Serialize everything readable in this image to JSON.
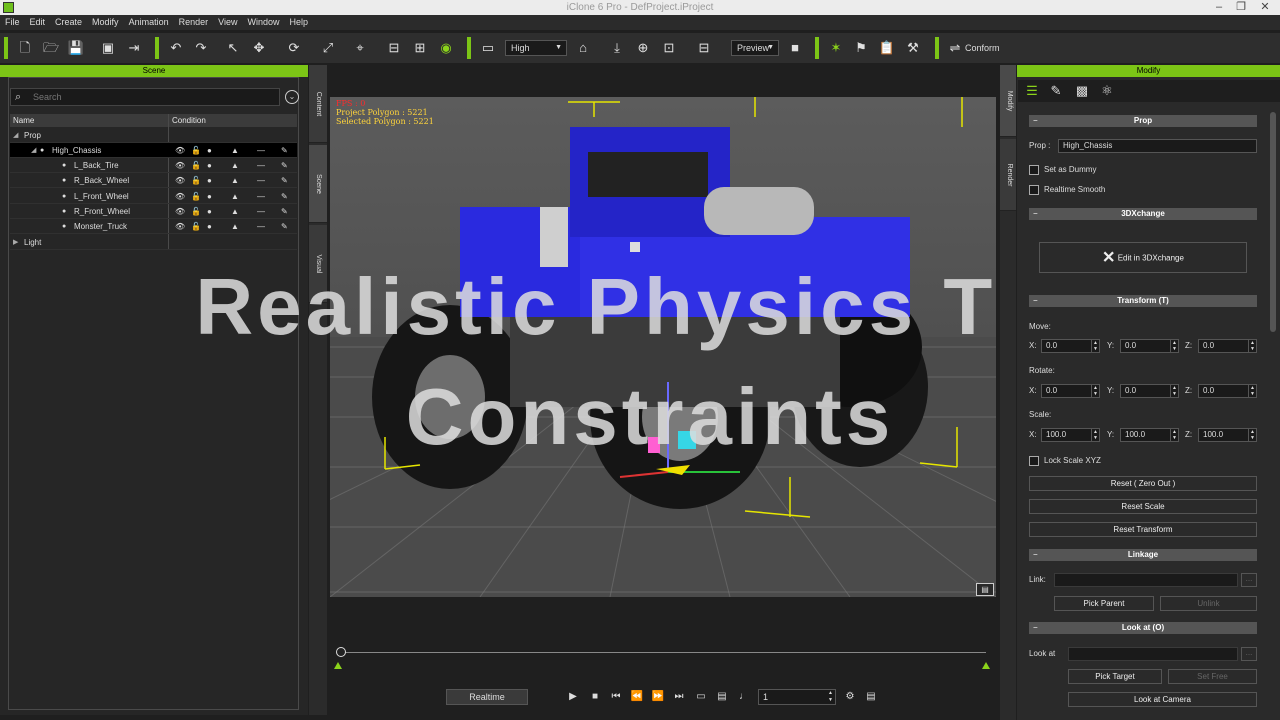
{
  "window": {
    "title": "iClone 6 Pro - DefProject.iProject",
    "controls": [
      "–",
      "❐",
      "✕"
    ]
  },
  "menu": [
    "File",
    "Edit",
    "Create",
    "Modify",
    "Animation",
    "Render",
    "View",
    "Window",
    "Help"
  ],
  "toolbar": {
    "quality_value": "High",
    "preview_value": "Preview",
    "conform_label": "Conform"
  },
  "scene": {
    "panel_title": "Scene",
    "search_placeholder": "Search",
    "col_name": "Name",
    "col_condition": "Condition",
    "tree": [
      {
        "label": "Prop",
        "level": 0,
        "expanded": true
      },
      {
        "label": "High_Chassis",
        "level": 1,
        "expanded": true,
        "selected": true
      },
      {
        "label": "L_Back_Tire",
        "level": 2
      },
      {
        "label": "R_Back_Wheel",
        "level": 2
      },
      {
        "label": "L_Front_Wheel",
        "level": 2
      },
      {
        "label": "R_Front_Wheel",
        "level": 2
      },
      {
        "label": "Monster_Truck",
        "level": 2
      },
      {
        "label": "Light",
        "level": 0,
        "expanded": false
      }
    ]
  },
  "side_tabs": [
    "Content",
    "Scene",
    "Visual"
  ],
  "right_side_tabs": [
    "Modify",
    "Render"
  ],
  "viewport": {
    "fps": "FPS : 0",
    "project_polygon": "Project Polygon : 5221",
    "selected_polygon": "Selected Polygon : 5221",
    "overlay_line1": "Realistic Physics Tire",
    "overlay_line2": "Constraints"
  },
  "playback": {
    "realtime_label": "Realtime",
    "frame_value": "1"
  },
  "modify": {
    "panel_title": "Modify",
    "prop_section": "Prop",
    "prop_label": "Prop :",
    "prop_value": "High_Chassis",
    "set_as_dummy": "Set as Dummy",
    "realtime_smooth": "Realtime Smooth",
    "xchange_section": "3DXchange",
    "edit_in_3dxchange": "Edit in 3DXchange",
    "transform_section": "Transform  (T)",
    "move_label": "Move:",
    "rotate_label": "Rotate:",
    "scale_label": "Scale:",
    "move": {
      "x": "0.0",
      "y": "0.0",
      "z": "0.0"
    },
    "rotate": {
      "x": "0.0",
      "y": "0.0",
      "z": "0.0"
    },
    "scale": {
      "x": "100.0",
      "y": "100.0",
      "z": "100.0"
    },
    "axis_x": "X:",
    "axis_y": "Y:",
    "axis_z": "Z:",
    "lock_scale": "Lock Scale XYZ",
    "reset_zero": "Reset ( Zero Out )",
    "reset_scale": "Reset Scale",
    "reset_transform": "Reset Transform",
    "linkage_section": "Linkage",
    "link_label": "Link:",
    "pick_parent": "Pick Parent",
    "unlink": "Unlink",
    "lookat_section": "Look at  (O)",
    "lookat_label": "Look at",
    "pick_target": "Pick Target",
    "set_free": "Set Free",
    "look_at_camera": "Look at Camera",
    "ellipsis": "..."
  },
  "colors": {
    "accent": "#7cc516",
    "panel": "#2a2a2a",
    "viewport": "#545454"
  }
}
